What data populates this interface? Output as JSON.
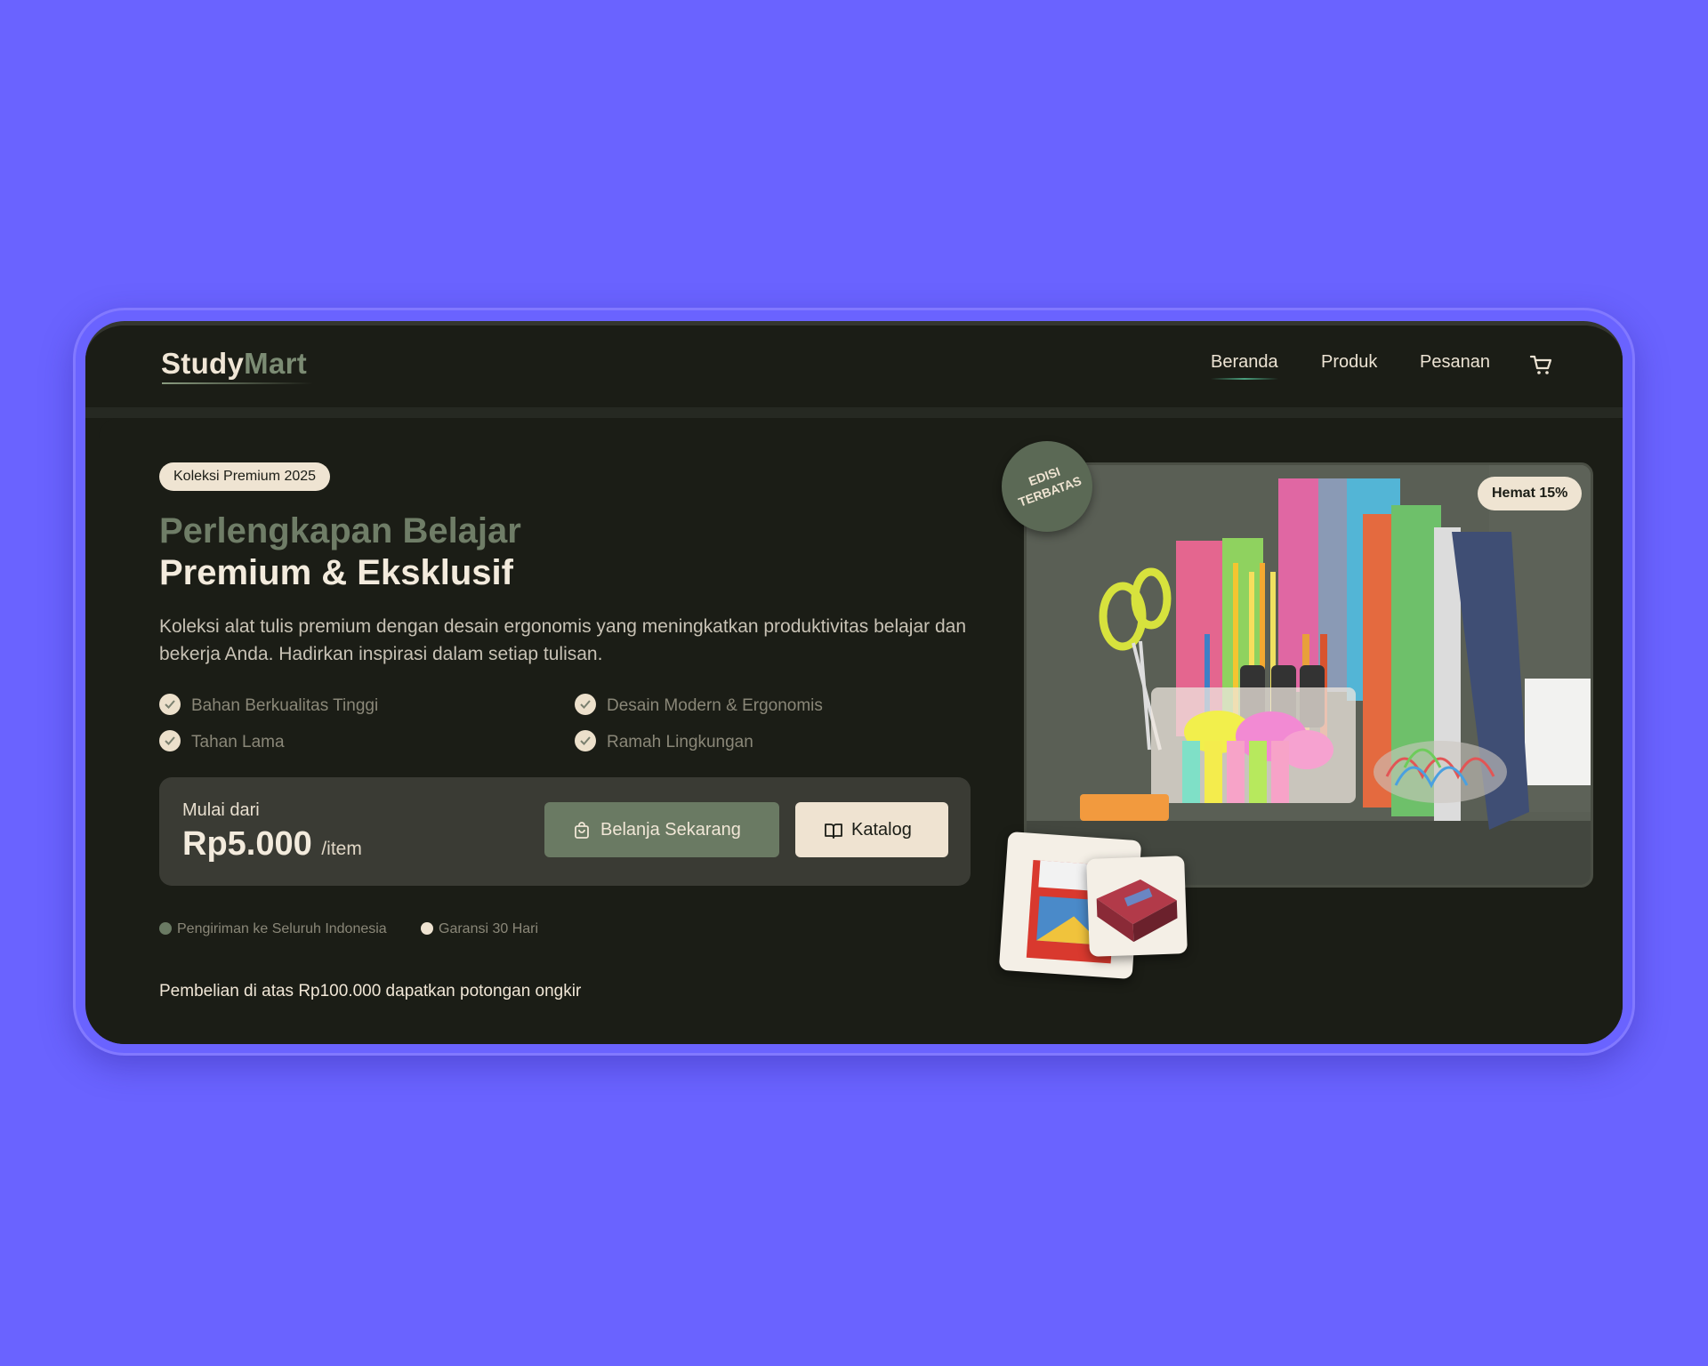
{
  "brand": {
    "part1": "Study",
    "part2": "Mart"
  },
  "nav": {
    "links": [
      "Beranda",
      "Produk",
      "Pesanan"
    ],
    "cart_icon": "cart-icon"
  },
  "hero": {
    "pill": "Koleksi Premium 2025",
    "title_line1": "Perlengkapan Belajar",
    "title_line2": "Premium & Eksklusif",
    "description": "Koleksi alat tulis premium dengan desain ergonomis yang meningkatkan produktivitas belajar dan bekerja Anda. Hadirkan inspirasi dalam setiap tulisan.",
    "features": [
      "Bahan Berkualitas Tinggi",
      "Desain Modern & Ergonomis",
      "Tahan Lama",
      "Ramah Lingkungan"
    ],
    "price_label": "Mulai dari",
    "price": "Rp5.000",
    "price_unit": "/item",
    "btn_shop": "Belanja Sekarang",
    "btn_catalog": "Katalog",
    "info": [
      "Pengiriman ke Seluruh Indonesia",
      "Garansi 30 Hari"
    ],
    "promo": "Pembelian di atas Rp100.000 dapatkan potongan ongkir"
  },
  "image": {
    "badge_save": "Hemat 15%",
    "badge_edisi_line1": "EDISI",
    "badge_edisi_line2": "TERBATAS"
  },
  "colors": {
    "background": "#6a63ff",
    "panel": "#1b1d16",
    "accent_green": "#6a7a63",
    "cream": "#efe3d1"
  }
}
